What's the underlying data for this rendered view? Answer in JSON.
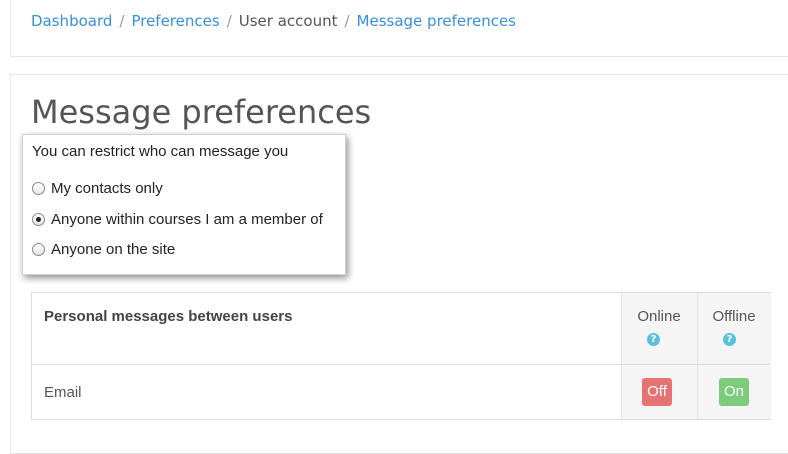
{
  "breadcrumb": {
    "items": [
      "Dashboard",
      "Preferences",
      "User account",
      "Message preferences"
    ],
    "separator": "/"
  },
  "page": {
    "title": "Message preferences"
  },
  "restrict_popover": {
    "heading": "You can restrict who can message you",
    "options": [
      {
        "label": "My contacts only",
        "checked": false
      },
      {
        "label": "Anyone within courses I am a member of",
        "checked": true
      },
      {
        "label": "Anyone on the site",
        "checked": false
      }
    ]
  },
  "preferences_table": {
    "section_title": "Personal messages between users",
    "columns": {
      "online": "Online",
      "offline": "Offline"
    },
    "help_icon": "question-circle-icon",
    "rows": [
      {
        "label": "Email",
        "online": "Off",
        "offline": "On"
      }
    ]
  },
  "colors": {
    "link": "#3a8fd6",
    "toggle_off": "#e57373",
    "toggle_on": "#7ccc7c",
    "help_icon": "#5bc0de"
  }
}
